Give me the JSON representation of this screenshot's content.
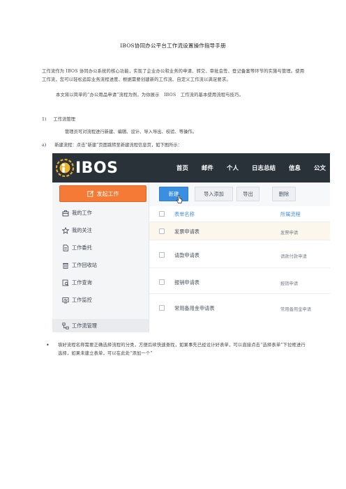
{
  "document": {
    "title": "IBOS协同办公平台工作流设置操作指导手册",
    "para1": "工作流作为 IBOS 协同办公系统的核心功能，实现了企业办公和业务的申请、转交、审批会签、登记备案等环节的实施与管理。使用工作流，您可以轻松追踪业务流程进度、根据需要创建新的工作流、自定义工作流以满足要求。",
    "para2": "本文将以简单的“办公用品申请”流程为例，为你展示　IBOS　工作流的基本使用流程与技巧。",
    "step1_num": "1)",
    "step1_label": "工作流管理",
    "step1_desc": "管理员可对流程进行新建、编辑、设计、导入导出、校验、等操作。",
    "stepa_num": "a)",
    "stepa_label": "新建流程：点击“新建”页面跳转至新建流程信息页，如下图所示：",
    "bullet_text": "填好流程名称需要正确选择流程的分类，方便后续快速查找，如果事先已经设计好表单，可以直接点击“选择表单”下拉框进行选择，如果未建立表单，可以在此处“添加一个”"
  },
  "screenshot": {
    "logo_text": "IBOS",
    "nav": [
      "首页",
      "邮件",
      "个人",
      "日志总结",
      "信息",
      "公文"
    ],
    "launch_button": "发起工作",
    "sidebar_items": [
      {
        "label": "我的工作",
        "icon": "briefcase-icon"
      },
      {
        "label": "我的关注",
        "icon": "star-icon"
      },
      {
        "label": "工作委托",
        "icon": "document-icon"
      },
      {
        "label": "工作回收站",
        "icon": "trash-icon"
      },
      {
        "label": "工作查询",
        "icon": "search-doc-icon"
      },
      {
        "label": "工作监控",
        "icon": "monitor-icon"
      },
      {
        "label": "工作流管理",
        "icon": "flow-icon"
      }
    ],
    "toolbar": {
      "new": "新建",
      "import": "导入添加",
      "export": "导出",
      "delete": "删除"
    },
    "table": {
      "headers": [
        "表单名称",
        "所属流程"
      ],
      "rows": [
        {
          "name": "发票申请表",
          "category": "发票申请"
        },
        {
          "name": "请款申请表",
          "category": "请款付款申请"
        },
        {
          "name": "报销申请表",
          "category": "报销申请"
        },
        {
          "name": "常用备用金申请表",
          "category": "常用备用金申请"
        }
      ]
    },
    "colors": {
      "topbar": "#293139",
      "accent_orange": "#f47a35",
      "primary_blue": "#3b8fe0",
      "highlight_row": "#fbf7ec"
    }
  }
}
